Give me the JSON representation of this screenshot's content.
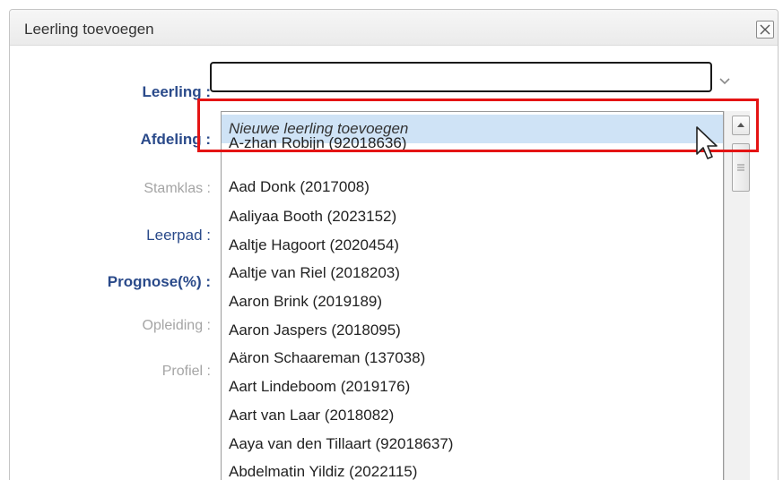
{
  "dialog": {
    "title": "Leerling toevoegen",
    "close_label": "Close"
  },
  "form": {
    "labels": {
      "leerling": "Leerling :",
      "afdeling": "Afdeling :",
      "stamklas": "Stamklas :",
      "leerpad": "Leerpad :",
      "prognose": "Prognose(%) :",
      "opleiding": "Opleiding :",
      "profiel": "Profiel :"
    },
    "leerling_value": ""
  },
  "dropdown": {
    "items": [
      "Nieuwe leerling toevoegen",
      "A-zhan Robijn (92018636)",
      "Aad Donk (2017008)",
      "Aaliyaa Booth (2023152)",
      "Aaltje Hagoort (2020454)",
      "Aaltje van Riel (2018203)",
      "Aaron Brink (2019189)",
      "Aaron Jaspers (2018095)",
      "Aäron Schaareman (137038)",
      "Aart Lindeboom (2019176)",
      "Aart van Laar (2018082)",
      "Aaya van den Tillaart (92018637)",
      "Abdelmatin Yildiz (2022115)"
    ]
  },
  "icons": {
    "close": "close-icon",
    "arrow": "chevron-down-icon",
    "scroll_up": "scroll-up-arrow-icon",
    "scroll_thumb": "scroll-thumb-grip-icon",
    "cursor": "mouse-pointer-icon"
  },
  "colors": {
    "label_blue": "#2a4a8a",
    "label_dim": "#a5a5a5",
    "highlight_bg": "#cfe3f6",
    "annotation_red": "#e41414"
  }
}
